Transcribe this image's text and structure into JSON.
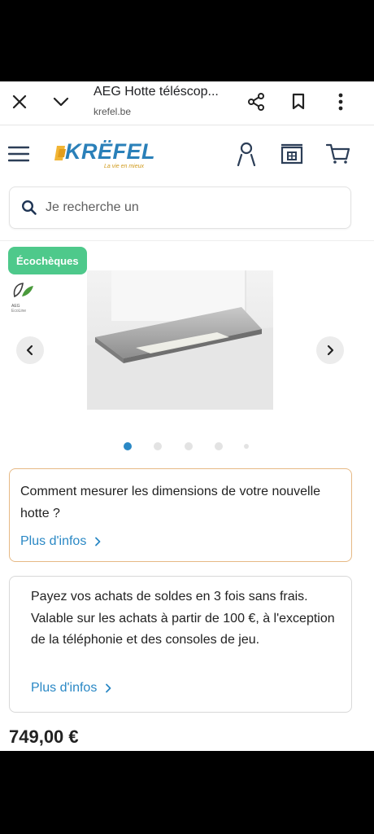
{
  "browser": {
    "title": "AEG Hotte téléscop...",
    "url": "krefel.be"
  },
  "header": {
    "logo_text": "KRËFEL",
    "logo_tagline": "La vie en mieux"
  },
  "search": {
    "placeholder": "Je recherche un"
  },
  "product": {
    "badge": "Écochèques",
    "eco_label_brand": "AEG",
    "eco_label_line": "EcoLine",
    "gallery_dots": 5,
    "active_dot_index": 0,
    "price": "749,00 €"
  },
  "info_card_1": {
    "text": "Comment mesurer les dimensions de votre nouvelle hotte ?",
    "link": "Plus d'infos"
  },
  "info_card_2": {
    "text": "Payez vos achats de soldes en 3 fois sans frais. Valable sur les achats à partir de 100 €, à l'exception de la téléphonie et des consoles de jeu.",
    "link": "Plus d'infos"
  },
  "colors": {
    "brand_blue": "#2a80b9",
    "link_blue": "#2a88c5",
    "badge_green": "#4ec98b",
    "card1_border": "#e6b985",
    "active_dot": "#2a88c5"
  }
}
